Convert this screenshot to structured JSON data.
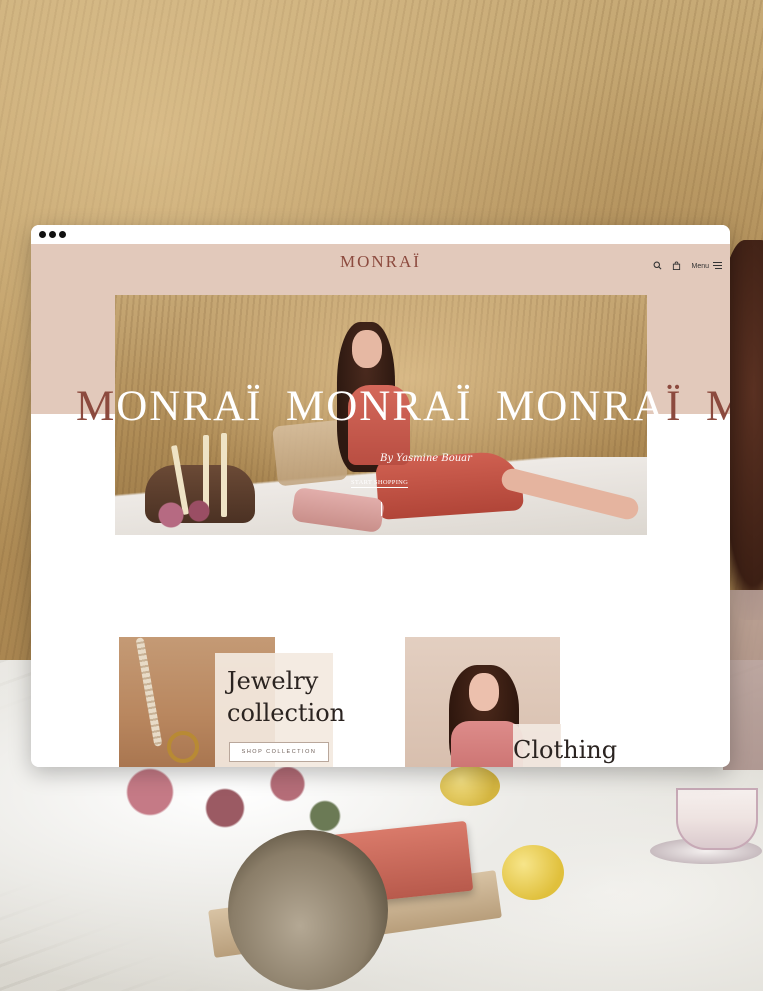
{
  "site": {
    "logo": "MONRAÏ",
    "menu_label": "Menu"
  },
  "hero": {
    "script_text": "By Yasmine Bouar",
    "cta_label": "START SHOPPING",
    "marquee": [
      "MONRAÏ",
      "MONRAÏ",
      "MONRAÏ",
      "M"
    ]
  },
  "collections": {
    "jewelry": {
      "title_line1": "Jewelry",
      "title_line2": "collection",
      "button_label": "SHOP COLLECTION"
    },
    "clothing": {
      "title": "Clothing"
    }
  },
  "colors": {
    "accent_brand": "#8c4a3e",
    "header_band": "#e2c9bb",
    "page_background": "#ffffff"
  },
  "icons": {
    "search": "search-icon",
    "bag": "bag-icon",
    "menu": "hamburger-icon"
  }
}
